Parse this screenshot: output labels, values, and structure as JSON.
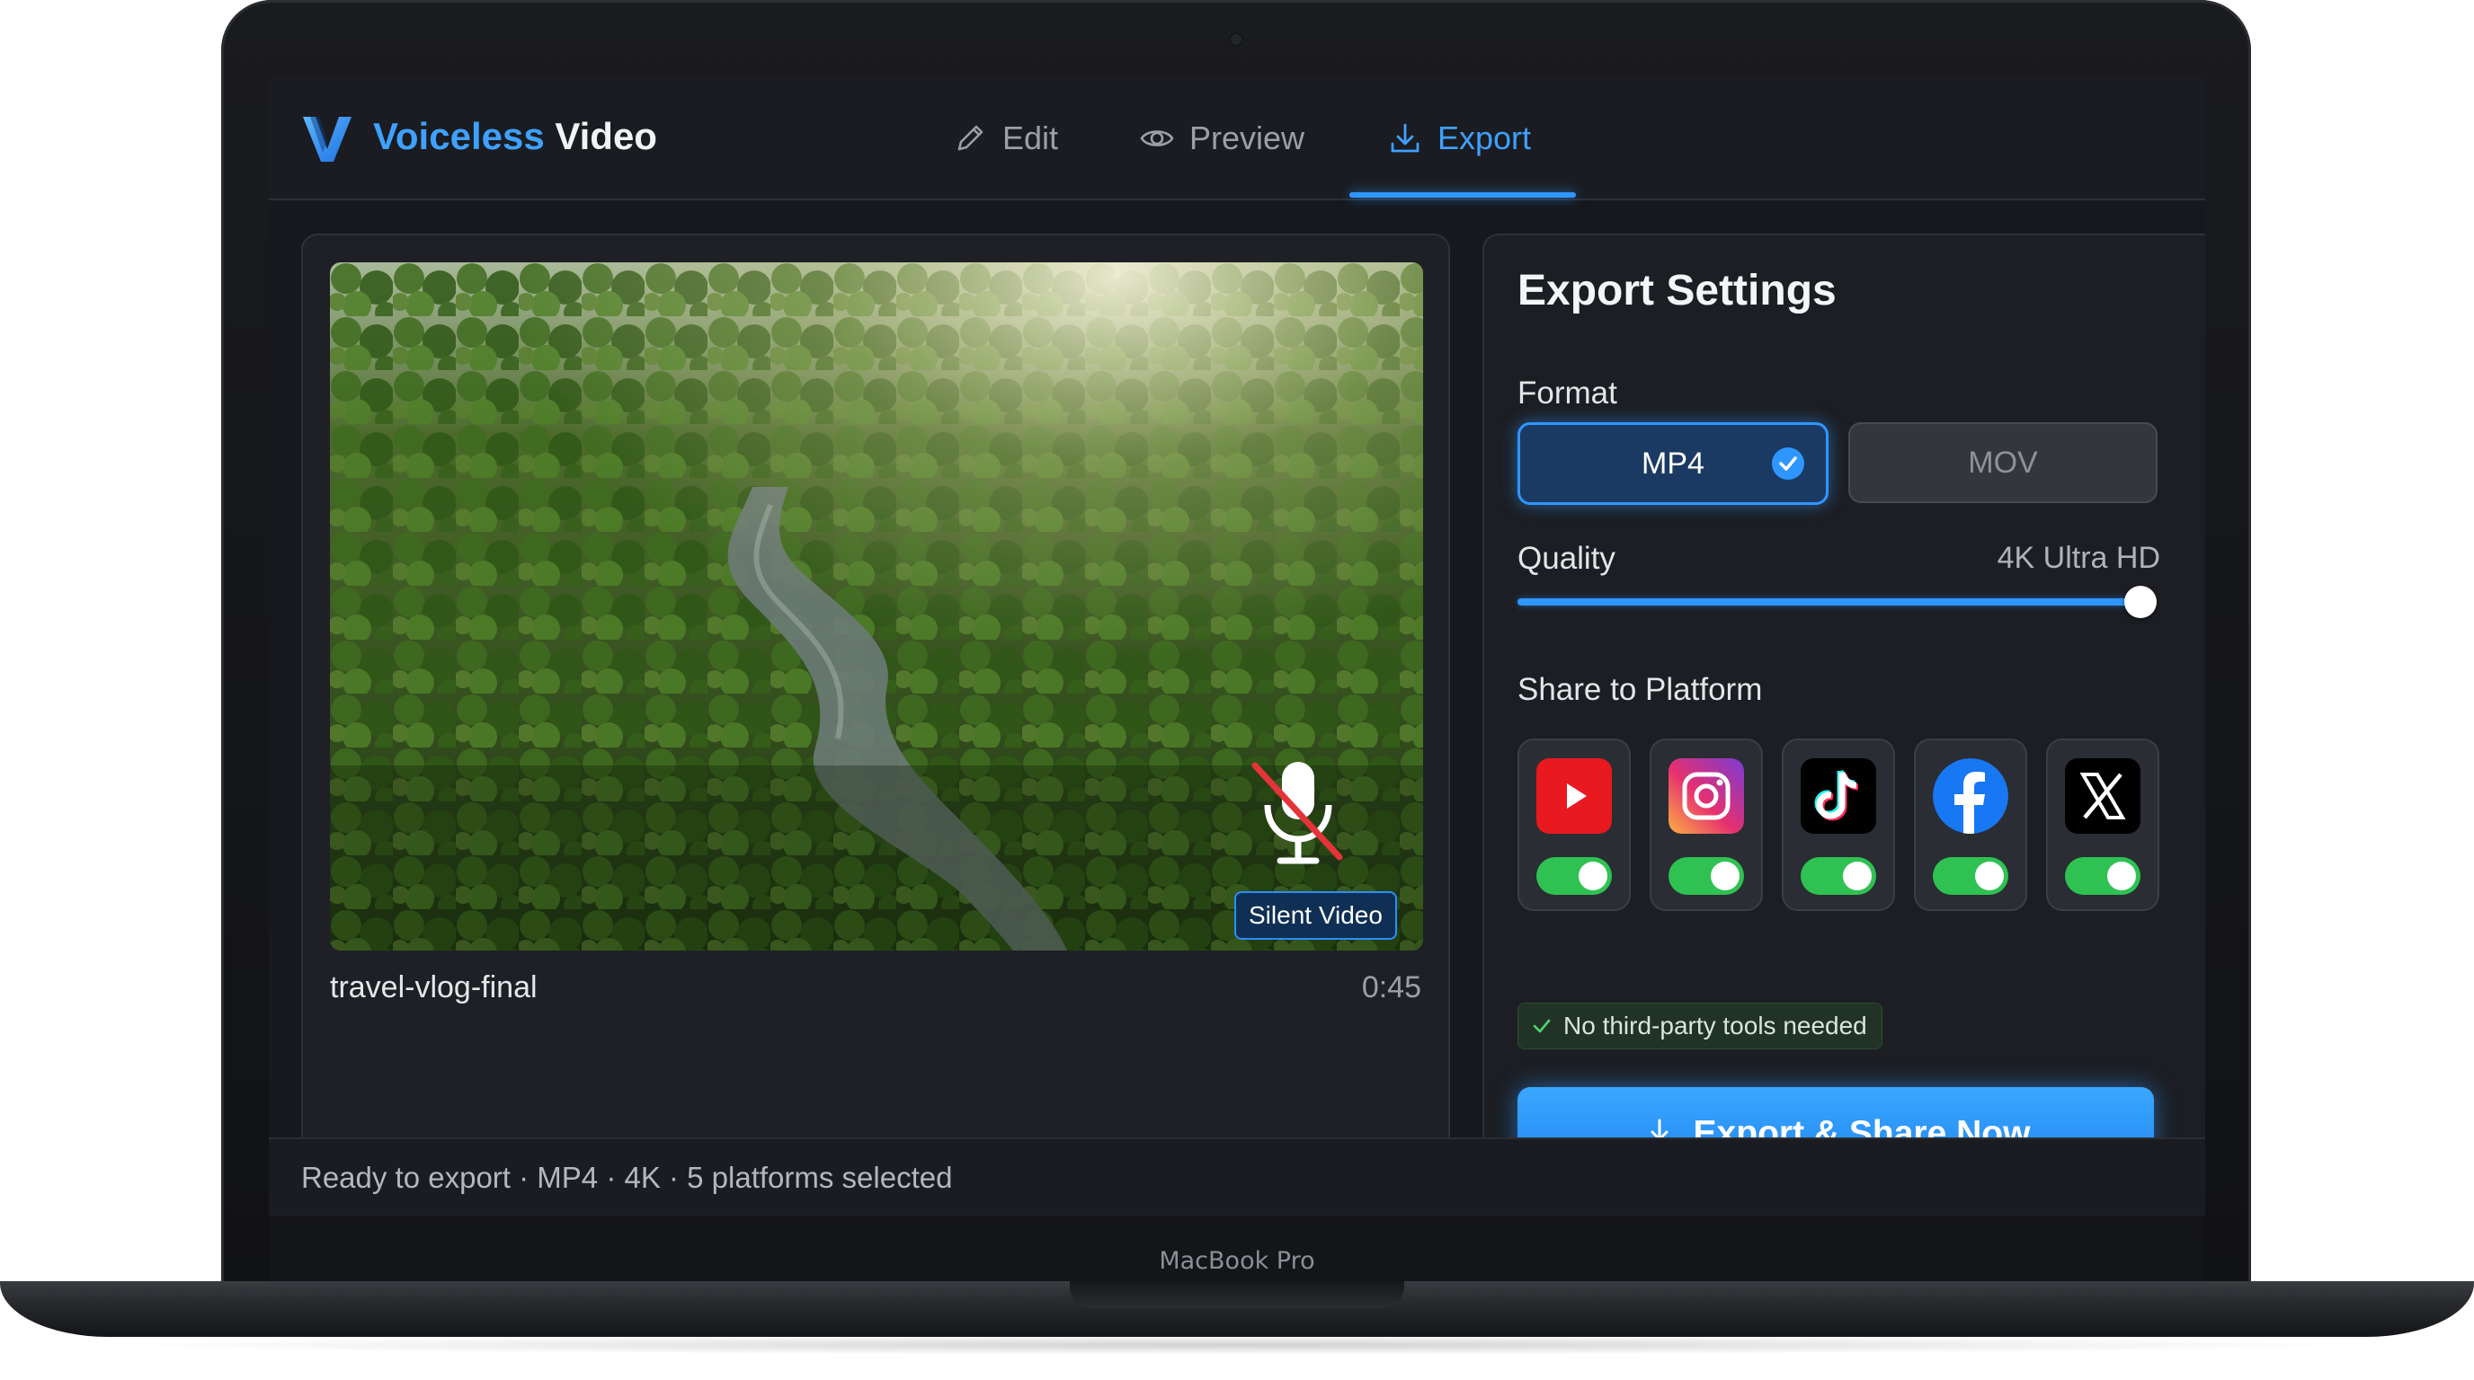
{
  "device": {
    "label": "MacBook Pro"
  },
  "app": {
    "name_accent": "Voiceless",
    "name_rest": "Video"
  },
  "tabs": [
    {
      "label": "Edit",
      "icon": "pencil-icon",
      "active": false
    },
    {
      "label": "Preview",
      "icon": "eye-icon",
      "active": false
    },
    {
      "label": "Export",
      "icon": "download-icon",
      "active": true
    }
  ],
  "video": {
    "badge": "Silent Video",
    "file_name": "travel-vlog-final",
    "duration": "0:45",
    "mute_icon": "microphone-muted-icon"
  },
  "settings": {
    "title": "Export Settings",
    "format_label": "Format",
    "formats": [
      {
        "label": "MP4",
        "selected": true
      },
      {
        "label": "MOV",
        "selected": false
      }
    ],
    "quality_label": "Quality",
    "quality_value": "4K Ultra HD",
    "quality_level": 1.0,
    "share_label": "Share to Platform",
    "platforms": [
      {
        "name": "youtube-icon",
        "enabled": true
      },
      {
        "name": "instagram-icon",
        "enabled": true
      },
      {
        "name": "tiktok-icon",
        "enabled": true
      },
      {
        "name": "facebook-icon",
        "enabled": true
      },
      {
        "name": "x-icon",
        "enabled": true
      }
    ],
    "notice": "No third-party tools needed",
    "cta": "Export & Share Now"
  },
  "status": {
    "text": "Ready to export · MP4 · 4K · 5 platforms selected"
  },
  "colors": {
    "accent": "#2f96ff",
    "toggle_on": "#2fc252",
    "background": "#16181d"
  }
}
